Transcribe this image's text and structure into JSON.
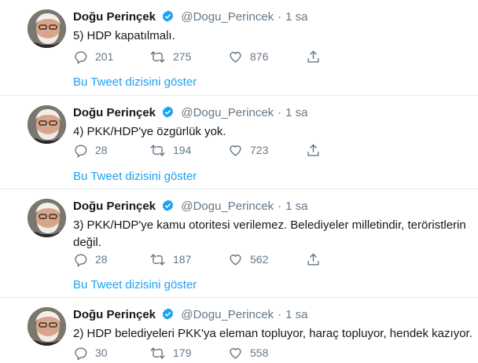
{
  "tweets": [
    {
      "author_name": "Doğu Perinçek",
      "handle": "@Dogu_Perincek",
      "separator": "·",
      "time": "1 sa",
      "text": "5) HDP kapatılmalı.",
      "replies": "201",
      "retweets": "275",
      "likes": "876",
      "thread_link": "Bu Tweet dizisini göster"
    },
    {
      "author_name": "Doğu Perinçek",
      "handle": "@Dogu_Perincek",
      "separator": "·",
      "time": "1 sa",
      "text": "4) PKK/HDP'ye özgürlük yok.",
      "replies": "28",
      "retweets": "194",
      "likes": "723",
      "thread_link": "Bu Tweet dizisini göster"
    },
    {
      "author_name": "Doğu Perinçek",
      "handle": "@Dogu_Perincek",
      "separator": "·",
      "time": "1 sa",
      "text": "3) PKK/HDP'ye kamu otoritesi verilemez. Belediyeler milletindir, teröristlerin değil.",
      "replies": "28",
      "retweets": "187",
      "likes": "562",
      "thread_link": "Bu Tweet dizisini göster"
    },
    {
      "author_name": "Doğu Perinçek",
      "handle": "@Dogu_Perincek",
      "separator": "·",
      "time": "1 sa",
      "text": "2) HDP belediyeleri PKK'ya eleman topluyor, haraç topluyor, hendek kazıyor.",
      "replies": "30",
      "retweets": "179",
      "likes": "558",
      "thread_link": ""
    }
  ],
  "icons": {
    "verified": "verified-badge-icon",
    "reply": "reply-icon",
    "retweet": "retweet-icon",
    "like": "heart-icon",
    "share": "share-icon"
  },
  "colors": {
    "link": "#1da1f2",
    "muted": "#657786",
    "text": "#14171a",
    "verified": "#1da1f2",
    "divider": "#e6ecf0"
  }
}
